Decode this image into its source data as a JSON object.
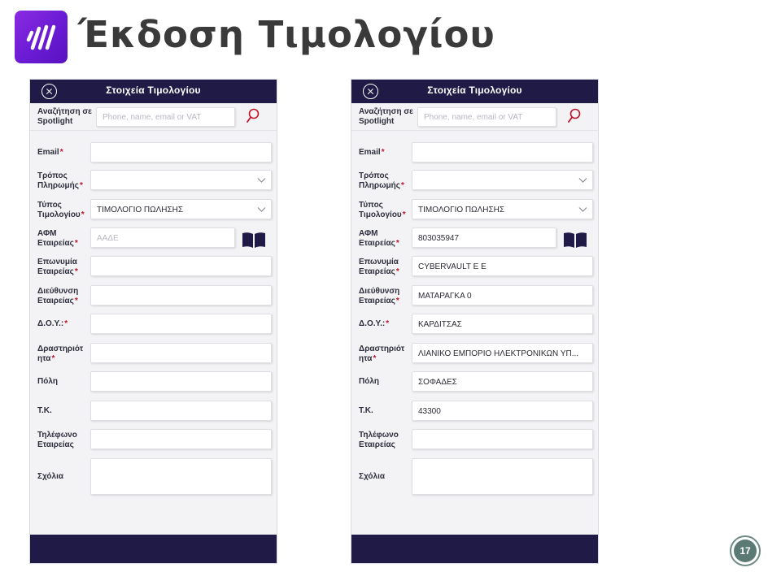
{
  "slide": {
    "title": "Έκδοση Τιμολογίου",
    "page_number": "17"
  },
  "phones": [
    {
      "header_title": "Στοιχεία Τιμολογίου",
      "search_label": "Αναζήτηση σε Spotlight",
      "search_placeholder": "Phone, name, email or VAT",
      "labels": {
        "email": "Email",
        "payment": "Τρόπος Πληρωμής",
        "invoice_type": "Τύπος Τιμολογίου",
        "vat": "ΑΦΜ Εταιρείας",
        "company_name": "Επωνυμία Εταιρείας",
        "address": "Διεύθυνση Εταιρείας",
        "tax_office": "Δ.Ο.Υ.:",
        "activity": "Δραστηριότ ητα",
        "city": "Πόλη",
        "postal_code": "Τ.Κ.",
        "phone": "Τηλέφωνο Εταιρείας",
        "comments": "Σχόλια"
      },
      "values": {
        "email": "",
        "payment": "",
        "invoice_type": "ΤΙΜΟΛΟΓΙΟ ΠΩΛΗΣΗΣ",
        "vat": "",
        "vat_placeholder": "ΑΑΔΕ",
        "company_name": "",
        "address": "",
        "tax_office": "",
        "activity": "",
        "city": "",
        "postal_code": "",
        "phone": "",
        "comments": ""
      }
    },
    {
      "header_title": "Στοιχεία Τιμολογίου",
      "search_label": "Αναζήτηση σε Spotlight",
      "search_placeholder": "Phone, name, email or VAT",
      "labels": {
        "email": "Email",
        "payment": "Τρόπος Πληρωμής",
        "invoice_type": "Τύπος Τιμολογίου",
        "vat": "ΑΦΜ Εταιρείας",
        "company_name": "Επωνυμία Εταιρείας",
        "address": "Διεύθυνση Εταιρείας",
        "tax_office": "Δ.Ο.Υ.:",
        "activity": "Δραστηριότ ητα",
        "city": "Πόλη",
        "postal_code": "Τ.Κ.",
        "phone": "Τηλέφωνο Εταιρείας",
        "comments": "Σχόλια"
      },
      "values": {
        "email": "",
        "payment": "",
        "invoice_type": "ΤΙΜΟΛΟΓΙΟ ΠΩΛΗΣΗΣ",
        "vat": "803035947",
        "vat_placeholder": "",
        "company_name": "CYBERVAULT Ε Ε",
        "address": "ΜΑΤΑΡΑΓΚΑ 0",
        "tax_office": "ΚΑΡΔΙΤΣΑΣ",
        "activity": "ΛΙΑΝΙΚΟ ΕΜΠΟΡΙΟ ΗΛΕΚΤΡΟΝΙΚΩΝ ΥΠ...",
        "city": "ΣΟΦΑΔΕΣ",
        "postal_code": "43300",
        "phone": "",
        "comments": ""
      }
    }
  ],
  "icons": {
    "logo": "bars-logo-icon",
    "close": "close-circle-icon",
    "search": "magnifier-icon",
    "book": "open-book-icon",
    "chevron": "chevron-down-icon"
  },
  "colors": {
    "header_bar": "#1f1a46",
    "logo_gradient": "#8a2be2",
    "required_mark": "#c0142a",
    "search_icon": "#c0142a",
    "page_badge": "#5c7a74"
  }
}
